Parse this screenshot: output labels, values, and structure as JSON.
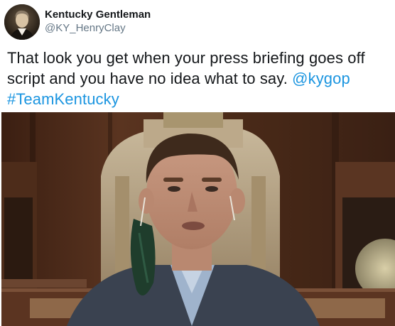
{
  "author": {
    "display_name": "Kentucky Gentleman",
    "handle": "@KY_HenryClay",
    "avatar_icon": "portrait-avatar"
  },
  "tweet": {
    "text": "That look you get when your press briefing goes off script and you have no idea what to say.",
    "mention": "@kygop",
    "hashtag": "#TeamKentucky"
  },
  "media": {
    "icon": "video-still-image"
  },
  "colors": {
    "link": "#1b95e0",
    "text": "#14171a",
    "secondary": "#657786"
  }
}
